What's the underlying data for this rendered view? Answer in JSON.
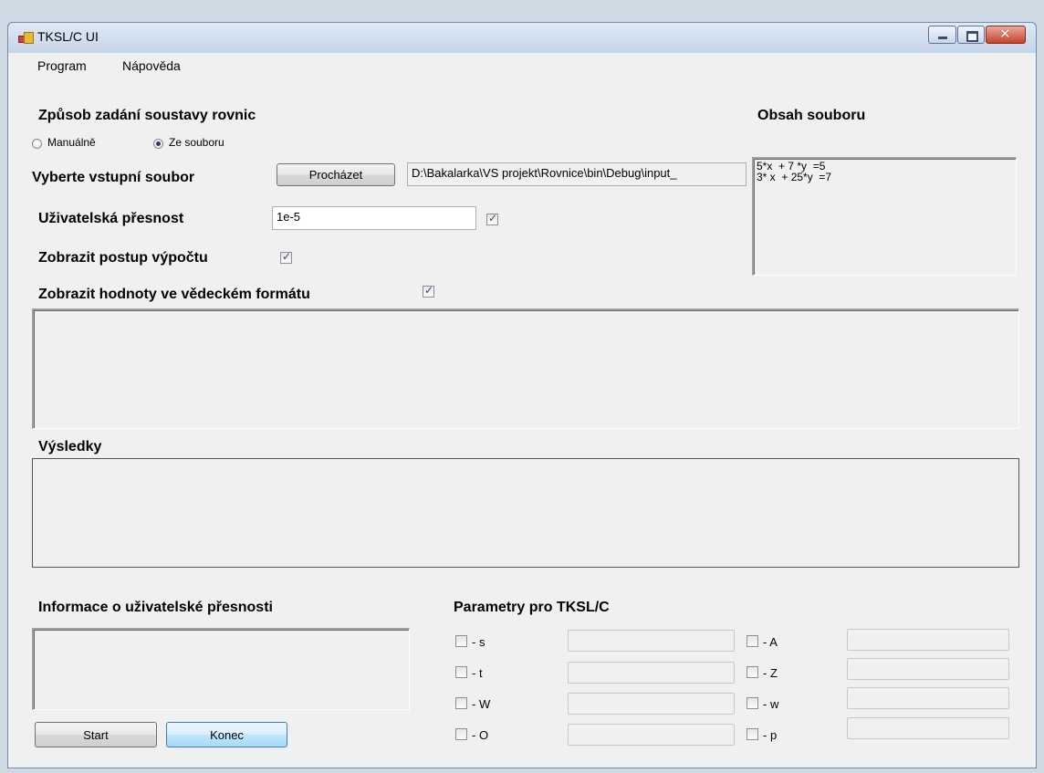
{
  "window": {
    "title": "TKSL/C UI"
  },
  "menu": {
    "items": [
      "Program",
      "Nápověda"
    ]
  },
  "input_mode": {
    "label": "Způsob zadání soustavy rovnic",
    "options": [
      {
        "label": "Manuálně",
        "selected": false
      },
      {
        "label": "Ze souboru",
        "selected": true
      }
    ]
  },
  "file_select": {
    "label": "Vyberte vstupní soubor",
    "browse_label": "Procházet",
    "path": "D:\\Bakalarka\\VS projekt\\Rovnice\\bin\\Debug\\input_"
  },
  "precision": {
    "label": "Uživatelská přesnost",
    "value": "1e-5",
    "checked": true
  },
  "show_steps": {
    "label": "Zobrazit postup výpočtu",
    "checked": true
  },
  "scientific": {
    "label": "Zobrazit hodnoty ve vědeckém formátu",
    "checked": true
  },
  "file_content": {
    "label": "Obsah souboru",
    "text": "5*x  + 7 *y  =5\n3* x  + 25*y  =7"
  },
  "results": {
    "label": "Výsledky"
  },
  "precision_info": {
    "label": "Informace o uživatelské přesnosti"
  },
  "buttons": {
    "start": "Start",
    "end": "Konec"
  },
  "params": {
    "label": "Parametry pro TKSL/C",
    "left": [
      {
        "flag": "- s",
        "checked": false
      },
      {
        "flag": "- t",
        "checked": false
      },
      {
        "flag": "- W",
        "checked": false
      },
      {
        "flag": "- O",
        "checked": false
      }
    ],
    "right": [
      {
        "flag": "- A",
        "checked": false
      },
      {
        "flag": "- Z",
        "checked": false
      },
      {
        "flag": "- w",
        "checked": false
      },
      {
        "flag": "- p",
        "checked": false
      }
    ]
  },
  "colors": {
    "window_bg": "#f0f0f0",
    "frame": "#cfd9e4",
    "close_button": "#c4432b"
  }
}
